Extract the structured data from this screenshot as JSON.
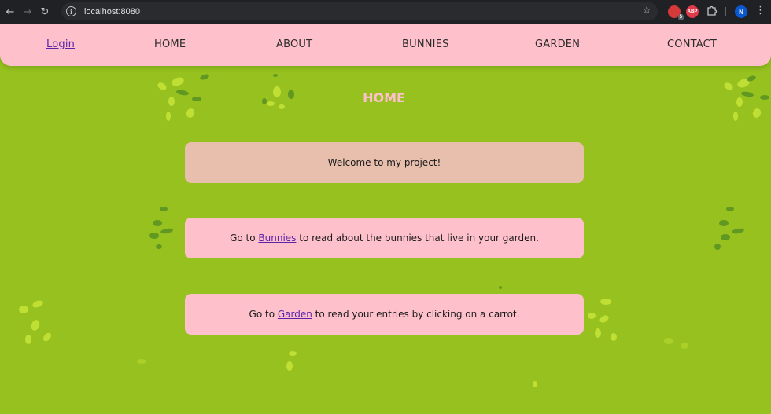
{
  "browser": {
    "url": "localhost:8080",
    "extension_badge": "5",
    "extension_abp": "ABP",
    "profile_initial": "N"
  },
  "nav": {
    "login": "Login",
    "home": "HOME",
    "about": "ABOUT",
    "bunnies": "BUNNIES",
    "garden": "GARDEN",
    "contact": "CONTACT"
  },
  "page": {
    "title": "HOME",
    "card1": "Welcome to my project!",
    "card2_prefix": "Go to ",
    "card2_link": "Bunnies",
    "card2_suffix": " to read about the bunnies that live in your garden.",
    "card3_prefix": "Go to ",
    "card3_link": "Garden",
    "card3_suffix": " to read your entries by clicking on a carrot."
  },
  "colors": {
    "background": "#96c11f",
    "nav": "#fec0cb",
    "card_welcome": "#e8bfad",
    "card": "#fec0cb",
    "link": "#5a23a8"
  }
}
